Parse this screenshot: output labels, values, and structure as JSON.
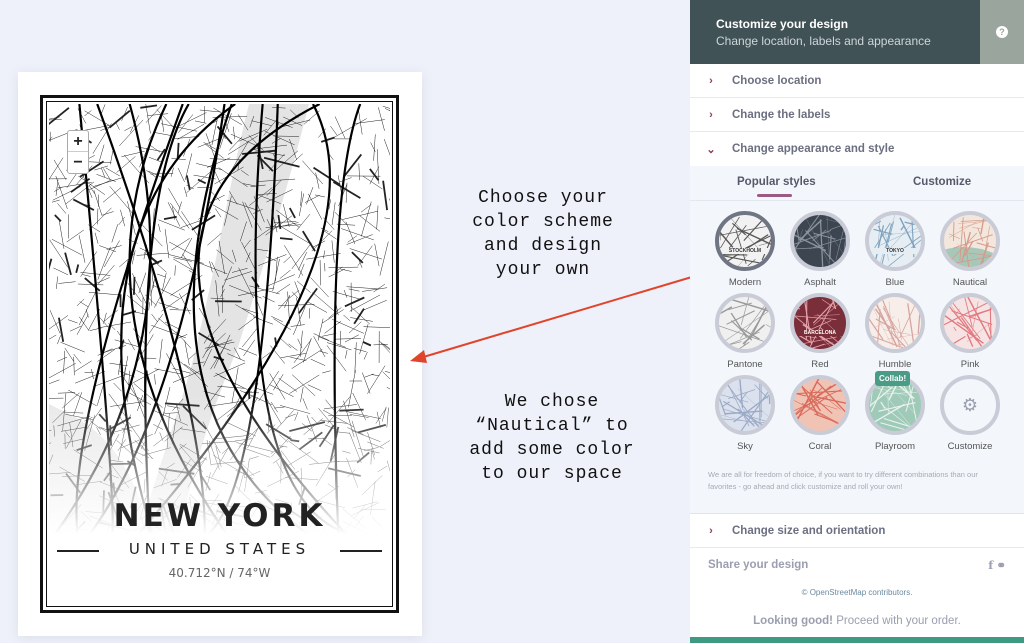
{
  "poster": {
    "city": "NEW YORK",
    "country": "UNITED STATES",
    "coords": "40.712°N / 74°W",
    "zoom_in": "+",
    "zoom_out": "−"
  },
  "annotations": {
    "top": "Choose your color scheme and design your own",
    "bottom": "We chose “Nautical” to add some color to our space",
    "arrow_color": "#e0452c"
  },
  "panel": {
    "title": "Customize your design",
    "subtitle": "Change location, labels and appearance",
    "help": "?",
    "sections": [
      {
        "label": "Choose location",
        "expanded": false
      },
      {
        "label": "Change the labels",
        "expanded": false
      },
      {
        "label": "Change appearance and style",
        "expanded": true
      }
    ],
    "tabs": [
      {
        "label": "Popular styles",
        "active": true
      },
      {
        "label": "Customize",
        "active": false
      }
    ],
    "styles": [
      {
        "label": "Modern",
        "color": "#f2f2f2",
        "line": "#555",
        "selected": true,
        "text": "STOCKHOLM"
      },
      {
        "label": "Asphalt",
        "color": "#3c4550",
        "line": "#8a95a0"
      },
      {
        "label": "Blue",
        "color": "#e7eef3",
        "line": "#7fa3bf",
        "text": "TOKYO"
      },
      {
        "label": "Nautical",
        "color": "#f3e6dc",
        "line": "#d49a8a",
        "water": "#a7c8b8"
      },
      {
        "label": "Pantone",
        "color": "#f0f0f0",
        "line": "#999"
      },
      {
        "label": "Red",
        "color": "#7a2e3a",
        "line": "#e4a0a8",
        "text": "BARCELONA"
      },
      {
        "label": "Humble",
        "color": "#f7eeea",
        "line": "#d7a5a0"
      },
      {
        "label": "Pink",
        "color": "#f6e4e4",
        "line": "#e07a80"
      },
      {
        "label": "Sky",
        "color": "#dbe2ee",
        "line": "#9aa9c6"
      },
      {
        "label": "Coral",
        "color": "#f0c3b5",
        "line": "#d96a5a"
      },
      {
        "label": "Playroom",
        "color": "#9fcab8",
        "line": "#e8f2ee",
        "badge": "Collab!"
      },
      {
        "label": "Customize",
        "color": "#f3f6fb",
        "icon": "gear-icon"
      }
    ],
    "description": "We are all for freedom of choice, if you want to try different combinations than our favorites - go ahead and click customize and roll your own!",
    "size_section": "Change size and orientation",
    "share": "Share your design",
    "share_icons": [
      "facebook-icon",
      "link-icon"
    ],
    "osm_prefix": "© ",
    "osm": "OpenStreetMap contributors.",
    "good_bold": "Looking good!",
    "good_rest": " Proceed with your order."
  }
}
